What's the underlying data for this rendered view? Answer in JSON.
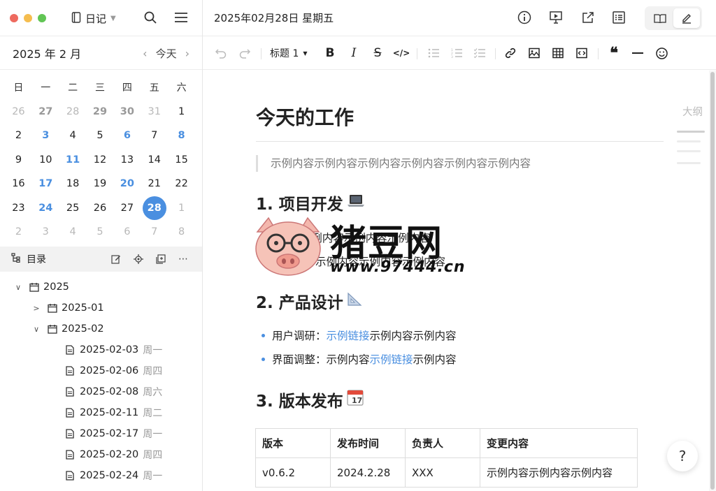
{
  "window": {
    "notebook": "日记",
    "date_title": "2025年02月28日 星期五"
  },
  "calendar": {
    "title": "2025 年 2 月",
    "today_label": "今天",
    "weekdays": [
      "日",
      "一",
      "二",
      "三",
      "四",
      "五",
      "六"
    ],
    "rows": [
      [
        "26",
        "27",
        "28",
        "29",
        "30",
        "31",
        "1"
      ],
      [
        "2",
        "3",
        "4",
        "5",
        "6",
        "7",
        "8"
      ],
      [
        "9",
        "10",
        "11",
        "12",
        "13",
        "14",
        "15"
      ],
      [
        "16",
        "17",
        "18",
        "19",
        "20",
        "21",
        "22"
      ],
      [
        "23",
        "24",
        "25",
        "26",
        "27",
        "28",
        "1"
      ],
      [
        "2",
        "3",
        "4",
        "5",
        "6",
        "7",
        "8"
      ]
    ],
    "accent_color": "#4a8fe0"
  },
  "toc": {
    "label": "目录",
    "tree": [
      {
        "label": "2025",
        "weekday": ""
      },
      {
        "label": "2025-01",
        "weekday": ""
      },
      {
        "label": "2025-02",
        "weekday": ""
      },
      {
        "label": "2025-02-03",
        "weekday": "周一"
      },
      {
        "label": "2025-02-06",
        "weekday": "周四"
      },
      {
        "label": "2025-02-08",
        "weekday": "周六"
      },
      {
        "label": "2025-02-11",
        "weekday": "周二"
      },
      {
        "label": "2025-02-17",
        "weekday": "周一"
      },
      {
        "label": "2025-02-20",
        "weekday": "周四"
      },
      {
        "label": "2025-02-24",
        "weekday": "周一"
      }
    ]
  },
  "toolbar": {
    "heading_select": "标题 1"
  },
  "outline": {
    "label": "大纲"
  },
  "document": {
    "title": "今天的工作",
    "quote": "示例内容示例内容示例内容示例内容示例内容示例内容",
    "section1": {
      "heading": "1. 项目开发",
      "items": [
        {
          "prefix": "",
          "link": "",
          "text": "feat: 示例内容示例内容示例内容"
        },
        {
          "prefix": "",
          "link": "",
          "text": "示例内容示例内容示例内容示例内容"
        }
      ]
    },
    "section2": {
      "heading": "2. 产品设计",
      "items": [
        {
          "prefix": "用户调研：",
          "link": "示例链接",
          "text": "示例内容示例内容"
        },
        {
          "prefix": "界面调整：示例内容",
          "link": "示例链接",
          "text": "示例内容"
        }
      ]
    },
    "section3": {
      "heading": "3. 版本发布",
      "table": {
        "headers": [
          "版本",
          "发布时间",
          "负责人",
          "变更内容"
        ],
        "rows": [
          [
            "v0.6.2",
            "2024.2.28",
            "XXX",
            "示例内容示例内容示例内容"
          ]
        ]
      }
    }
  },
  "help_label": "?",
  "watermark": {
    "text": "猪豆网",
    "url": "www.97444.cn"
  }
}
